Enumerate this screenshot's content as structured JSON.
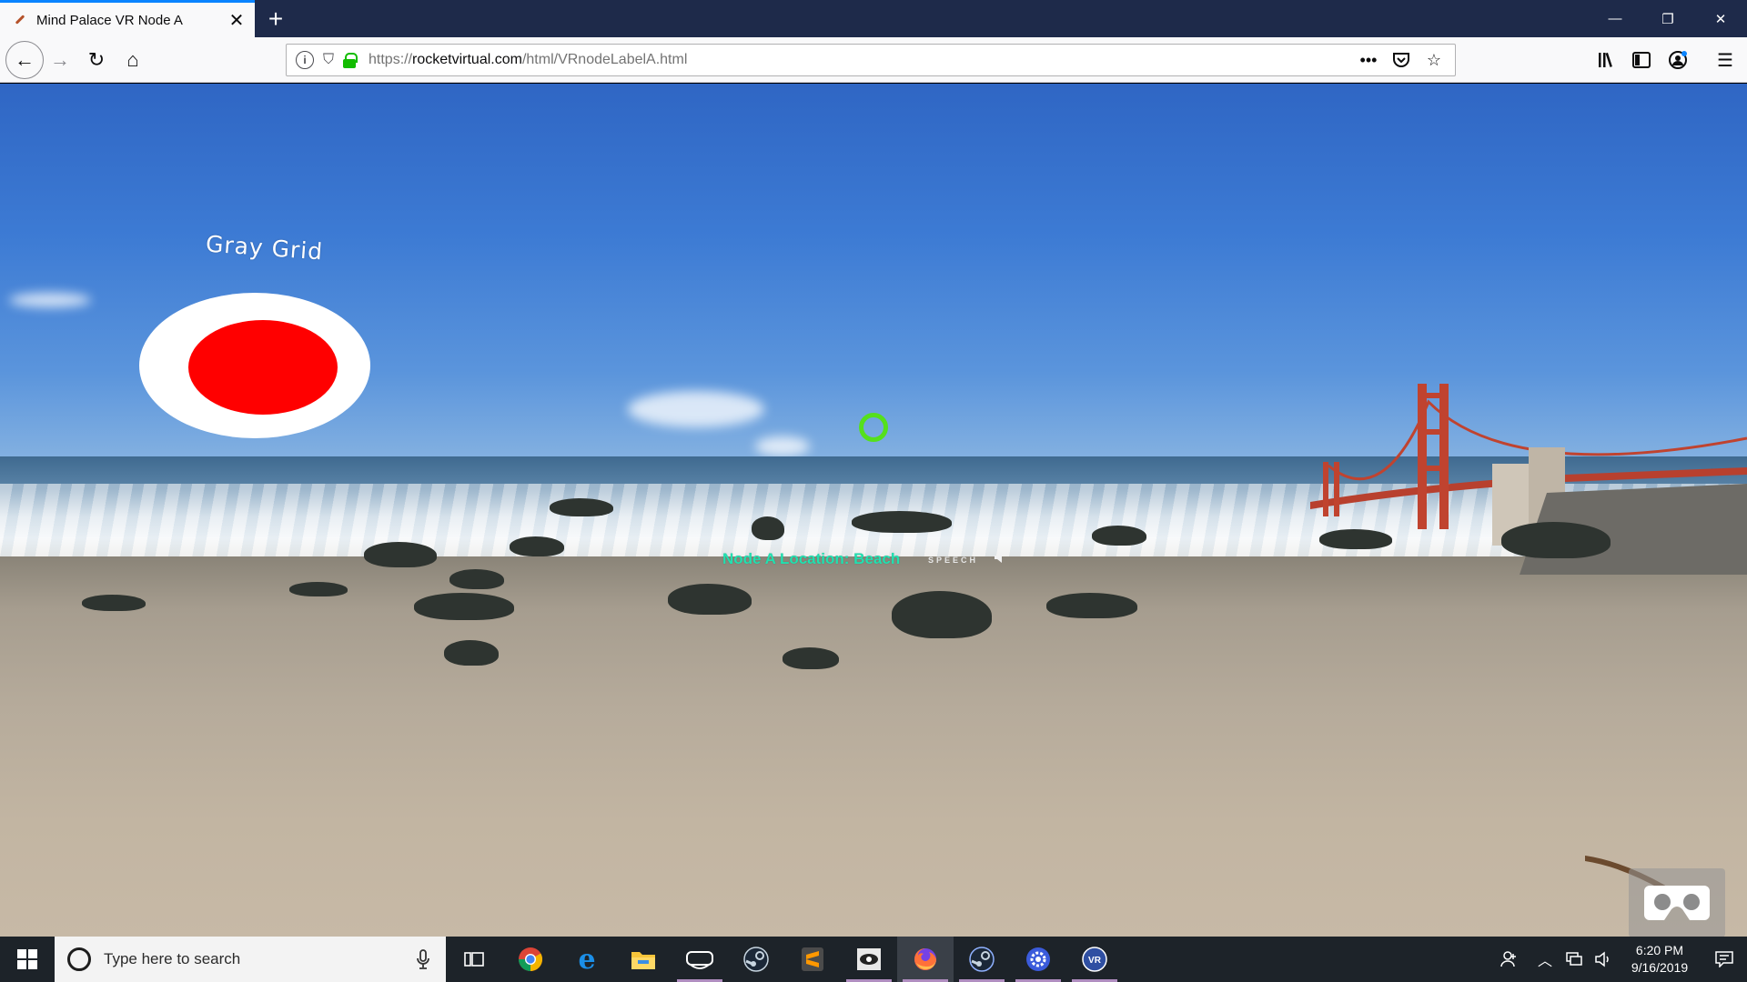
{
  "browser": {
    "tab_title": "Mind Palace VR Node A",
    "new_tab_label": "+",
    "url_scheme": "https://",
    "url_host": "rocketvirtual.com",
    "url_path": "/html/VRnodeLabelA.html",
    "accent_color": "#0a84ff",
    "lock_color": "#12bc00"
  },
  "scene": {
    "menu_label": "Gray Grid",
    "node_label": "Node A Location: Beach",
    "speech_label": "SPEECH",
    "reticle_color": "#55e01c",
    "node_label_color": "#22e0b0",
    "menu_disc_color": "#ff0000"
  },
  "taskbar": {
    "search_placeholder": "Type here to search",
    "clock_time": "6:20 PM",
    "clock_date": "9/16/2019",
    "apps": [
      "task-view",
      "chrome",
      "edge",
      "file-explorer",
      "vr-headset",
      "steam",
      "sublime-text",
      "eye-app",
      "firefox",
      "steam-vr",
      "settings-gear",
      "vr-app"
    ]
  }
}
